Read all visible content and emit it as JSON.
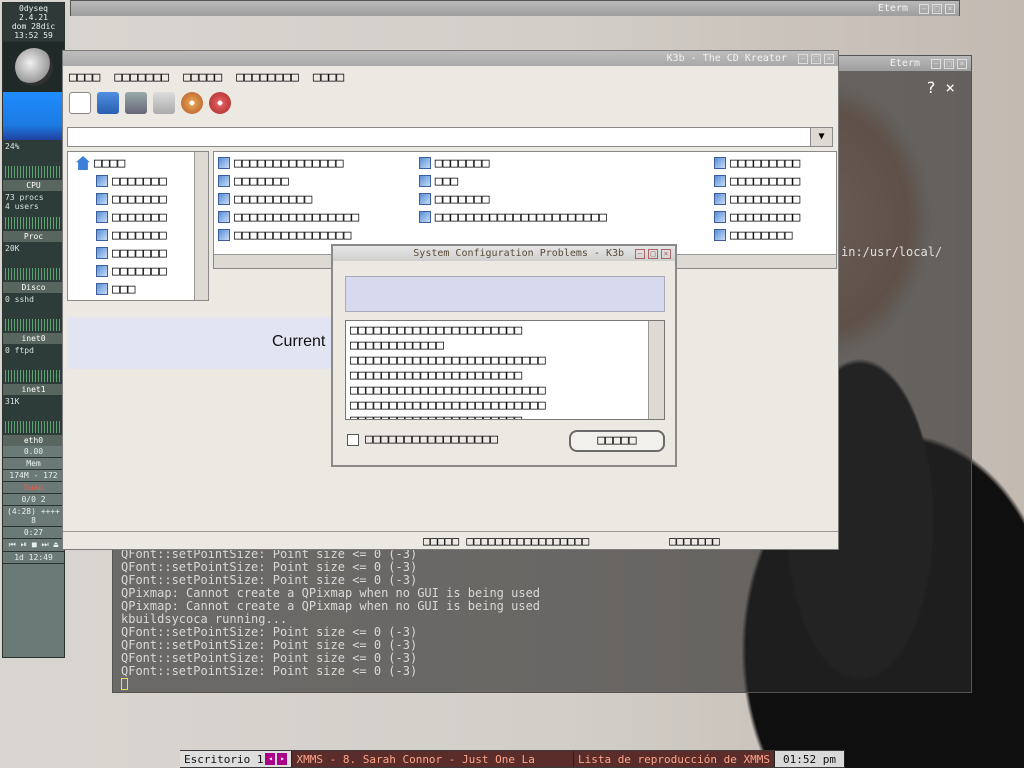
{
  "dock": {
    "host": "0dyseq",
    "kernel": "2.4.21",
    "date": "dom 28dic",
    "time": "13:52",
    "time_suffix": "59",
    "cpu_percent": "24%",
    "cpu_label": "CPU",
    "procs": "73 procs",
    "users": "4 users",
    "proc_label": "Proc",
    "proc_value": "20K",
    "disk_label": "Disco",
    "disk_value": "0 sshd",
    "inet0_label": "inet0",
    "inet0_value": "0 ftpd",
    "inet1_label": "inet1",
    "inet1_value": "31K",
    "eth_label": "eth0",
    "eth_value": "0.00",
    "mem_label": "Mem",
    "mem_value": "174M - 172",
    "swap_label": "Swap",
    "mail_value": "0/0",
    "mail_count": "2",
    "battery": "(4:28) ++++ 8",
    "timer": "0:27",
    "uptime": "1d 12:49"
  },
  "eterm_top": {
    "title": "Eterm"
  },
  "eterm_main": {
    "title": "Eterm",
    "help_label": "?",
    "path_fragment": "in:/usr/local/",
    "lines": [
      "QFont::setPointSize: Point size <= 0 (-3)",
      "QFont::setPointSize: Point size <= 0 (-3)",
      "QFont::setPointSize: Point size <= 0 (-3)",
      "QPixmap: Cannot create a QPixmap when no GUI is being used",
      "QPixmap: Cannot create a QPixmap when no GUI is being used",
      "kbuildsycoca running...",
      "QFont::setPointSize: Point size <= 0 (-3)",
      "QFont::setPointSize: Point size <= 0 (-3)",
      "QFont::setPointSize: Point size <= 0 (-3)",
      "QFont::setPointSize: Point size <= 0 (-3)"
    ]
  },
  "k3b": {
    "title": "K3b - The CD Kreator",
    "menu": [
      "□□□□",
      "□□□□□□□",
      "□□□□□",
      "□□□□□□□□",
      "□□□□"
    ],
    "tree": [
      "□□□□",
      "□□□□□□□",
      "□□□□□□□",
      "□□□□□□□",
      "□□□□□□□",
      "□□□□□□□",
      "□□□□□□□",
      "□□□"
    ],
    "files_col1": [
      "□□□□□□□□□□□□□□",
      "□□□□□□□",
      "□□□□□□□□□□",
      "□□□□□□□□□□□□□□□□",
      "□□□□□□□□□□□□□□□"
    ],
    "files_col2": [
      "□□□□□□□",
      "□□□",
      "□□□□□□□",
      "□□□□□□□□□□□□□□□□□□□□□□"
    ],
    "files_col3": [
      "□□□□□□□□□",
      "□□□□□□□□□",
      "□□□□□□□□□",
      "□□□□□□□□□",
      "□□□□□□□□"
    ],
    "banner_text": "Current",
    "player_labels": [
      "□□□□□□",
      "□□□□□□",
      "□□□□□□"
    ],
    "status_main": "□□□□□ □□□□□□□□□□□□□□□□□",
    "status_right": "□□□□□□□"
  },
  "dialog": {
    "title": "System Configuration Problems - K3b",
    "banner_title": "",
    "lines": [
      "□□□□□□□□□□□□□□□□□□□□□□",
      "□□□□□□□□□□□□",
      "□□□□□□□□□□□□□□□□□□□□□□□□□",
      "□□□□□□□□□□□□□□□□□□□□□□",
      "□□□□□□□□□□□□□□□□□□□□□□□□□",
      "□□□□□□□□□□□□□□□□□□□□□□□□□",
      "□□□□□□□□□□□□□□□□□□□□□□"
    ],
    "checkbox_label": "□□□□□□□□□□□□□□□□□",
    "ok_label": "□□□□□"
  },
  "taskbar": {
    "desktop": "Escritorio 1",
    "xmms_title": "XMMS - 8. Sarah Connor - Just One La",
    "playlist": "Lista de reproducción de XMMS",
    "clock": "01:52 pm"
  },
  "colors": {
    "dock_bg": "#6b7a76",
    "taskbar_xmms": "#5a2d2b",
    "dialog_title_text": "#5a4a35"
  }
}
